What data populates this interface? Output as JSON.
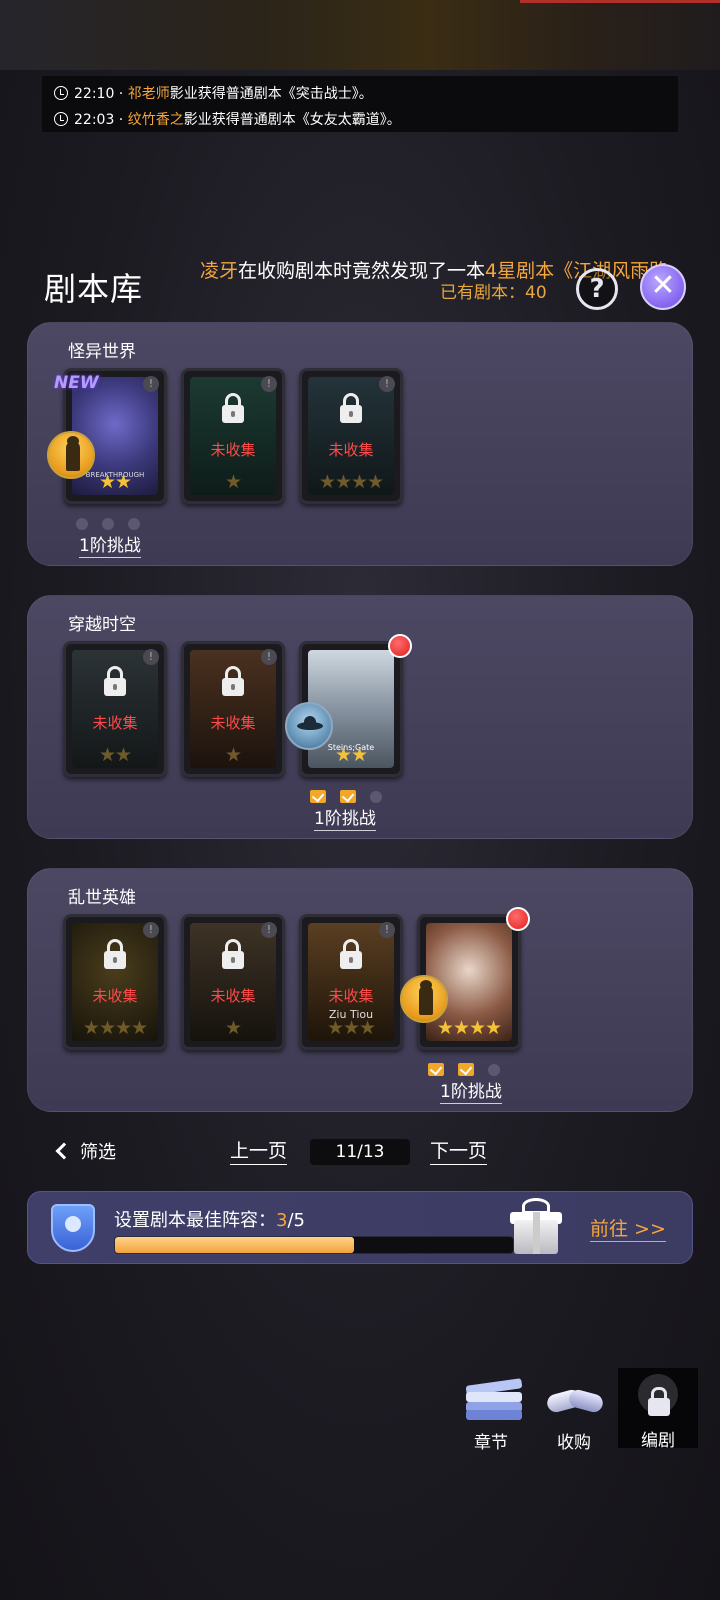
{
  "news": [
    {
      "time": "22:10",
      "sep": " · ",
      "name": "祁老师",
      "text": "影业获得普通剧本《突击战士》。"
    },
    {
      "time": "22:03",
      "sep": " · ",
      "name": "纹竹香之",
      "text": "影业获得普通剧本《女友太霸道》。"
    }
  ],
  "header": {
    "title": "剧本库",
    "marquee": {
      "name": "凌牙",
      "text": "在收购剧本时竟然发现了一本",
      "highlight": "4星剧本《江湖风雨路"
    },
    "owned_label": "已有剧本：",
    "owned_count": "40",
    "help_label": "?",
    "close_label": "✕"
  },
  "groups": [
    {
      "title": "怪异世界",
      "challenge": "1阶挑战",
      "cards": [
        {
          "status": "new",
          "new_tag": "NEW",
          "caption": "BREAKTHROUGH",
          "stars": 2,
          "max": 2
        },
        {
          "status": "locked",
          "label": "未收集",
          "stars": 1,
          "max": 1
        },
        {
          "status": "locked",
          "label": "未收集",
          "stars": 4,
          "max": 4
        }
      ]
    },
    {
      "title": "穿越时空",
      "challenge": "1阶挑战",
      "cards": [
        {
          "status": "locked",
          "label": "未收集",
          "stars": 2,
          "max": 2
        },
        {
          "status": "locked",
          "label": "未收集",
          "stars": 1,
          "max": 1
        },
        {
          "status": "owned",
          "caption": "Steins;Gate",
          "stars": 2,
          "max": 2
        }
      ]
    },
    {
      "title": "乱世英雄",
      "challenge": "1阶挑战",
      "cards": [
        {
          "status": "locked",
          "label": "未收集",
          "stars": 4,
          "max": 4
        },
        {
          "status": "locked",
          "label": "未收集",
          "stars": 1,
          "max": 1
        },
        {
          "status": "locked",
          "label": "未收集",
          "caption": "Ziu Tiou",
          "stars": 3,
          "max": 3
        },
        {
          "status": "owned",
          "stars": 4,
          "max": 4
        }
      ]
    }
  ],
  "pager": {
    "filter_label": "筛选",
    "prev_label": "上一页",
    "page": "11/13",
    "next_label": "下一页"
  },
  "lineup": {
    "label": "设置剧本最佳阵容：",
    "current": "3",
    "total": "/5",
    "progress": 0.6,
    "goto_label": "前往 >>"
  },
  "bottom_nav": [
    {
      "label": "章节",
      "icon": "book-icon"
    },
    {
      "label": "收购",
      "icon": "handshake-icon"
    },
    {
      "label": "编剧",
      "icon": "screenwriter-lock-icon"
    }
  ],
  "colors": {
    "accent": "#f6a63b",
    "locked_text": "#ff4a4a",
    "star": "#f3c13a",
    "panel": "#443f5b"
  }
}
